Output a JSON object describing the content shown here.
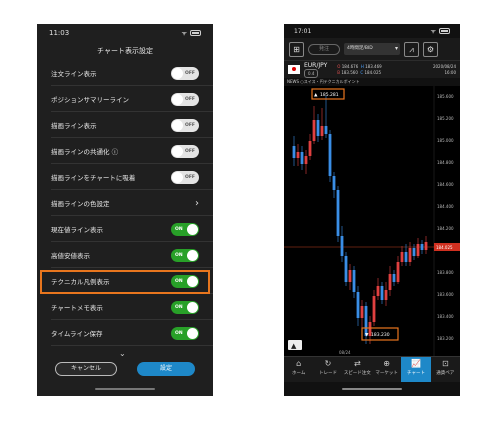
{
  "left": {
    "time": "11:03",
    "status_right": "ᯤ 84",
    "title": "チャート表示設定",
    "rows": [
      {
        "label": "注文ライン表示",
        "type": "toggle",
        "state": "OFF"
      },
      {
        "label": "ポジションサマリーライン",
        "type": "toggle",
        "state": "OFF"
      },
      {
        "label": "描画ライン表示",
        "type": "toggle",
        "state": "OFF"
      },
      {
        "label": "描画ラインの共通化 ⓘ",
        "type": "toggle",
        "state": "OFF"
      },
      {
        "label": "描画ラインをチャートに吸着",
        "type": "toggle",
        "state": "OFF"
      },
      {
        "label": "描画ラインの色設定",
        "type": "chevron",
        "state": ""
      },
      {
        "label": "現在値ライン表示",
        "type": "toggle",
        "state": "ON"
      },
      {
        "label": "高値安値表示",
        "type": "toggle",
        "state": "ON"
      },
      {
        "label": "テクニカル凡例表示",
        "type": "toggle",
        "state": "ON"
      },
      {
        "label": "チャートメモ表示",
        "type": "toggle",
        "state": "ON"
      },
      {
        "label": "タイムライン保存",
        "type": "toggle",
        "state": "ON"
      }
    ],
    "highlight_color": "#e8761e",
    "cancel_label": "キャンセル",
    "set_label": "設定"
  },
  "right": {
    "time": "17:01",
    "status_right": "ᯤ",
    "toolbar": {
      "pill": "発注",
      "select": "4時間足/BID"
    },
    "quote": {
      "pair": "EUR/JPY",
      "multiplier": "0.4",
      "o_label": "O",
      "o": "184.676",
      "h_label": "H",
      "h": "183.469",
      "b_label": "B",
      "b": "183.560",
      "c_label": "C",
      "c": "184.025",
      "date": "2020/08/24",
      "time": "16:00"
    },
    "news": "NEWS ○スイス・円テクニカルポイント",
    "chart_data": {
      "type": "candlestick",
      "y_ticks": [
        "185.600",
        "185.200",
        "185.000",
        "184.800",
        "184.600",
        "184.400",
        "184.200",
        "183.800",
        "183.600",
        "183.400",
        "183.200"
      ],
      "high_label": "185.281",
      "low_label": "183.230",
      "current_price": "184.025",
      "x_label": "08/24",
      "up_color": "#e04040",
      "down_color": "#3a8ee6",
      "marker_color": "#e8761e"
    },
    "tabs": [
      {
        "icon": "⌂",
        "label": "ホーム"
      },
      {
        "icon": "↻",
        "label": "トレード"
      },
      {
        "icon": "⇄",
        "label": "スピード注文"
      },
      {
        "icon": "⊕",
        "label": "マーケット"
      },
      {
        "icon": "📈",
        "label": "チャート"
      },
      {
        "icon": "⊡",
        "label": "通貨ペア"
      }
    ]
  }
}
